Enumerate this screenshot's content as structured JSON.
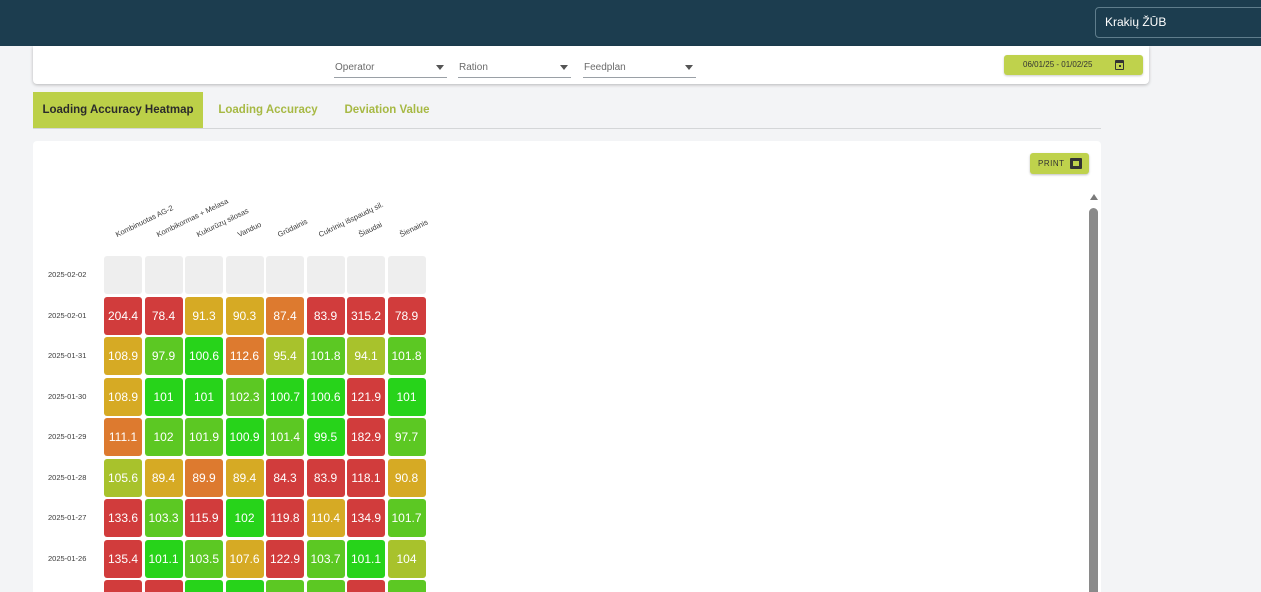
{
  "header": {
    "farm_selector": "Krakių ŽŪB"
  },
  "filters": {
    "operator": {
      "placeholder": "Operator"
    },
    "ration": {
      "placeholder": "Ration"
    },
    "feedplan": {
      "placeholder": "Feedplan"
    },
    "date_range": "06/01/25 - 01/02/25",
    "calendar_icon": "calendar-icon"
  },
  "tabs": [
    {
      "label": "Loading Accuracy Heatmap",
      "active": true
    },
    {
      "label": "Loading Accuracy",
      "active": false
    },
    {
      "label": "Deviation Value",
      "active": false
    }
  ],
  "print_button": {
    "label": "PRINT",
    "icon": "pdf-icon"
  },
  "colors": {
    "topbar": "#1c3d4f",
    "accent": "#bcd048",
    "heat_green": "#27d31a",
    "heat_lightgreen": "#5cc823",
    "heat_olive": "#a8c22c",
    "heat_yellow": "#d6aa24",
    "heat_orange": "#dd7a2f",
    "heat_red": "#d13c3c",
    "empty": "#eeeeee"
  },
  "heatmap": {
    "columns": [
      "Kombinuotas AG-2",
      "Kombikormas + Melasa",
      "Kukurūzų silosas",
      "Vanduo",
      "Grūdainis",
      "Cukrinių išspaudų sil.",
      "Šiaudai",
      "Šienainis"
    ],
    "rows": [
      {
        "date": "2025-02-02",
        "values": [
          "",
          "",
          "",
          "",
          "",
          "",
          "",
          ""
        ],
        "levels": [
          "empty",
          "empty",
          "empty",
          "empty",
          "empty",
          "empty",
          "empty",
          "empty"
        ]
      },
      {
        "date": "2025-02-01",
        "values": [
          "204.4",
          "78.4",
          "91.3",
          "90.3",
          "87.4",
          "83.9",
          "315.2",
          "78.9"
        ],
        "levels": [
          "red",
          "red",
          "yellow",
          "yellow",
          "orange",
          "red",
          "red",
          "red"
        ]
      },
      {
        "date": "2025-01-31",
        "values": [
          "108.9",
          "97.9",
          "100.6",
          "112.6",
          "95.4",
          "101.8",
          "94.1",
          "101.8"
        ],
        "levels": [
          "yellow",
          "lightgreen",
          "green",
          "orange",
          "olive",
          "lightgreen",
          "olive",
          "lightgreen"
        ]
      },
      {
        "date": "2025-01-30",
        "values": [
          "108.9",
          "101",
          "101",
          "102.3",
          "100.7",
          "100.6",
          "121.9",
          "101"
        ],
        "levels": [
          "yellow",
          "green",
          "green",
          "lightgreen",
          "green",
          "green",
          "red",
          "green"
        ]
      },
      {
        "date": "2025-01-29",
        "values": [
          "111.1",
          "102",
          "101.9",
          "100.9",
          "101.4",
          "99.5",
          "182.9",
          "97.7"
        ],
        "levels": [
          "orange",
          "lightgreen",
          "lightgreen",
          "green",
          "lightgreen",
          "green",
          "red",
          "lightgreen"
        ]
      },
      {
        "date": "2025-01-28",
        "values": [
          "105.6",
          "89.4",
          "89.9",
          "89.4",
          "84.3",
          "83.9",
          "118.1",
          "90.8"
        ],
        "levels": [
          "olive",
          "yellow",
          "orange",
          "yellow",
          "red",
          "red",
          "red",
          "yellow"
        ]
      },
      {
        "date": "2025-01-27",
        "values": [
          "133.6",
          "103.3",
          "115.9",
          "102",
          "119.8",
          "110.4",
          "134.9",
          "101.7"
        ],
        "levels": [
          "red",
          "lightgreen",
          "red",
          "green",
          "red",
          "yellow",
          "red",
          "lightgreen"
        ]
      },
      {
        "date": "2025-01-26",
        "values": [
          "135.4",
          "101.1",
          "103.5",
          "107.6",
          "122.9",
          "103.7",
          "101.1",
          "104"
        ],
        "levels": [
          "red",
          "green",
          "lightgreen",
          "yellow",
          "red",
          "lightgreen",
          "green",
          "olive"
        ]
      },
      {
        "date": "",
        "values": [
          "",
          "",
          "",
          "",
          "",
          "",
          "",
          ""
        ],
        "levels": [
          "red",
          "red",
          "green",
          "green",
          "lightgreen",
          "lightgreen",
          "red",
          "lightgreen"
        ]
      }
    ]
  }
}
